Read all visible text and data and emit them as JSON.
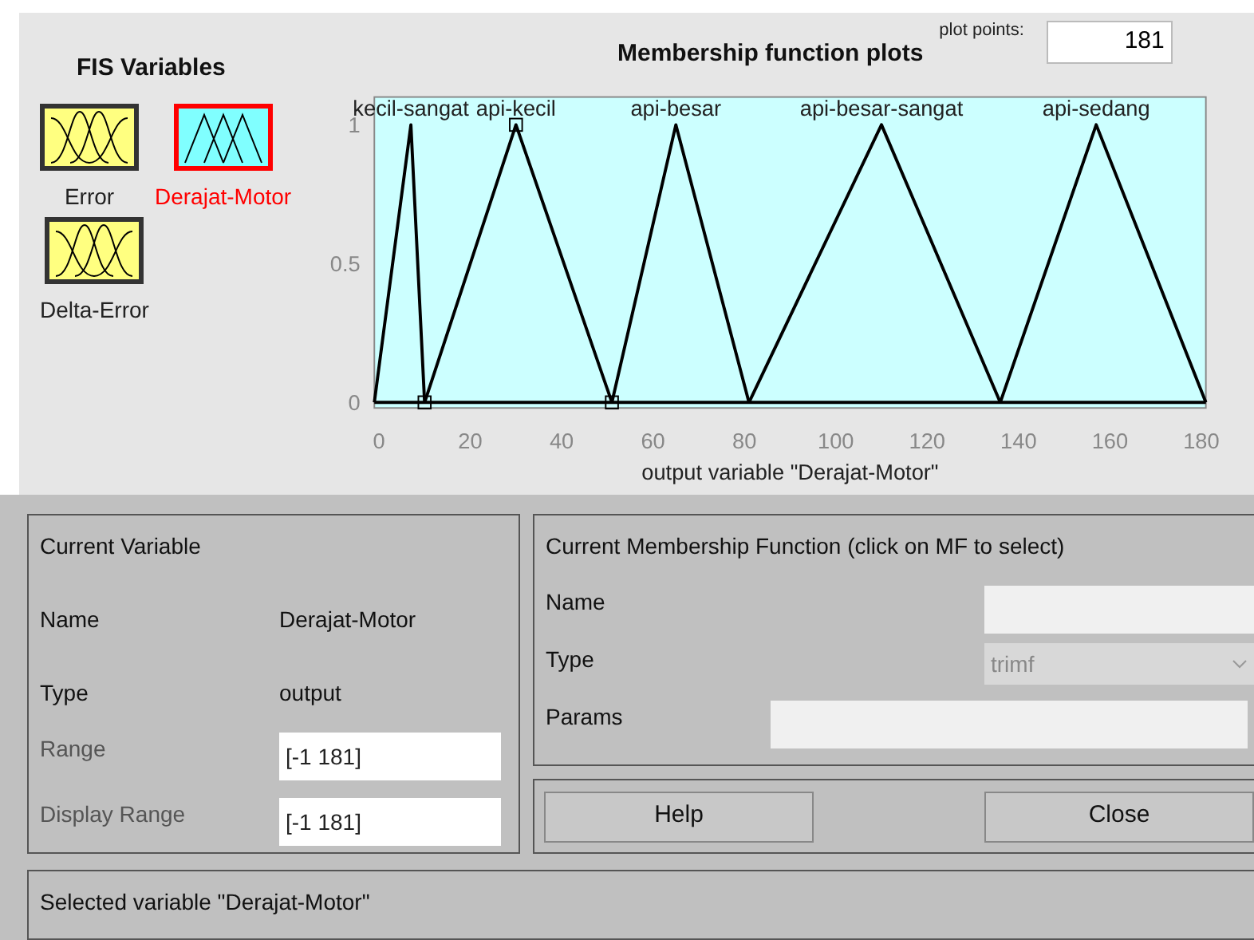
{
  "fis_variables": {
    "title": "FIS Variables",
    "items": [
      {
        "label": "Error",
        "kind": "input",
        "selected": false
      },
      {
        "label": "Derajat-Motor",
        "kind": "output",
        "selected": true
      },
      {
        "label": "Delta-Error",
        "kind": "input",
        "selected": false
      }
    ]
  },
  "plot": {
    "title": "Membership function plots",
    "plot_points_label": "plot points:",
    "plot_points": "181",
    "chart_data": {
      "type": "line",
      "xlabel": "output variable \"Derajat-Motor\"",
      "x": [
        -1,
        7,
        10,
        30,
        51,
        65,
        81,
        110,
        136,
        157,
        181
      ],
      "xlim": [
        -1,
        181
      ],
      "ylim": [
        -0.02,
        1.1
      ],
      "xticks": [
        0,
        20,
        40,
        60,
        80,
        100,
        120,
        140,
        160,
        180
      ],
      "yticks": [
        0,
        0.5,
        1
      ],
      "series": [
        {
          "name": "kecil-sangat",
          "color": "#000000",
          "values": [
            0,
            1,
            0,
            null,
            null,
            null,
            null,
            null,
            null,
            null,
            null
          ]
        },
        {
          "name": "api-kecil",
          "color": "#000000",
          "values": [
            null,
            null,
            0,
            1,
            0,
            null,
            null,
            null,
            null,
            null,
            null
          ]
        },
        {
          "name": "api-besar",
          "color": "#000000",
          "values": [
            null,
            null,
            null,
            null,
            0,
            1,
            0,
            null,
            null,
            null,
            null
          ]
        },
        {
          "name": "api-besar-sangat",
          "color": "#000000",
          "values": [
            null,
            null,
            null,
            null,
            null,
            null,
            0,
            1,
            0,
            null,
            null
          ]
        },
        {
          "name": "api-sedang",
          "color": "#000000",
          "values": [
            null,
            null,
            null,
            null,
            null,
            null,
            null,
            null,
            0,
            1,
            0
          ]
        }
      ]
    },
    "curve_handles": [
      false,
      true,
      false,
      false,
      false
    ]
  },
  "current_variable": {
    "title": "Current Variable",
    "name_label": "Name",
    "name": "Derajat-Motor",
    "type_label": "Type",
    "type": "output",
    "range_label": "Range",
    "range": "[-1 181]",
    "display_range_label": "Display Range",
    "display_range": "[-1 181]"
  },
  "current_mf": {
    "title": "Current Membership Function (click on MF to select)",
    "name_label": "Name",
    "name_disabled": true,
    "type_label": "Type",
    "type": "trimf",
    "type_disabled": true,
    "params_label": "Params",
    "params_disabled": true
  },
  "buttons": [
    "Help",
    "Close"
  ],
  "status": "Selected variable \"Derajat-Motor\""
}
